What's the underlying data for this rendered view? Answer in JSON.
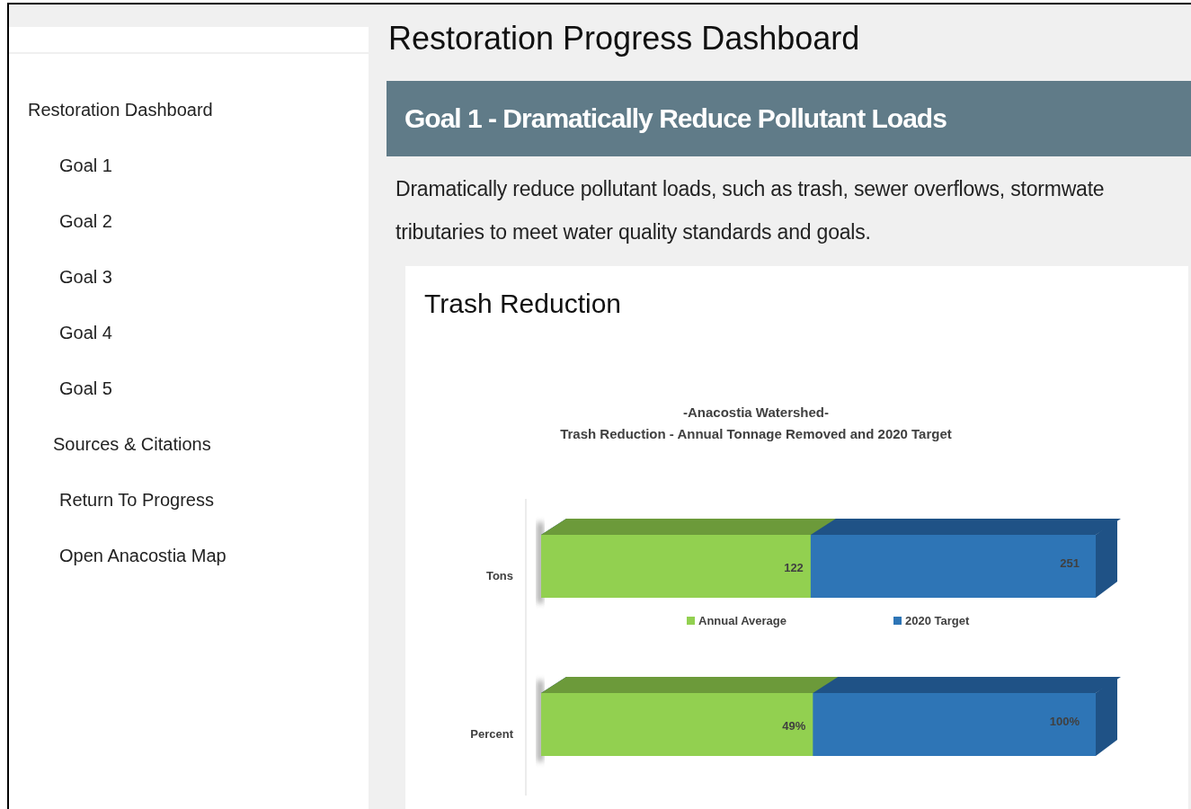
{
  "sidebar": {
    "items": [
      {
        "label": "Restoration Dashboard",
        "kind": "top"
      },
      {
        "label": "Goal 1",
        "kind": "sub"
      },
      {
        "label": "Goal 2",
        "kind": "sub"
      },
      {
        "label": "Goal 3",
        "kind": "sub"
      },
      {
        "label": "Goal 4",
        "kind": "sub"
      },
      {
        "label": "Goal 5",
        "kind": "sub"
      },
      {
        "label": "Sources & Citations",
        "kind": "mid"
      },
      {
        "label": "Return To Progress",
        "kind": "sub"
      },
      {
        "label": "Open Anacostia Map",
        "kind": "sub"
      }
    ]
  },
  "page_title": "Restoration Progress Dashboard",
  "goal": {
    "heading": "Goal 1 - Dramatically Reduce Pollutant Loads",
    "description_lines": [
      "Dramatically reduce pollutant loads, such as trash, sewer overflows, stormwate",
      "tributaries to meet water quality standards and goals."
    ]
  },
  "card": {
    "title": "Trash Reduction",
    "graphic": {
      "supertitle": "-Anacostia Watershed-",
      "title": "Trash Reduction - Annual Tonnage Removed and 2020 Target",
      "legend": [
        {
          "label": "Annual Average",
          "color": "#92d050"
        },
        {
          "label": "2020 Target",
          "color": "#2e75b6"
        }
      ],
      "rows": [
        {
          "label": "Tons",
          "level": 0.486,
          "average_label": "122",
          "target_label": "251"
        },
        {
          "label": "Percent",
          "level": 0.49,
          "average_label": "49%",
          "target_label": "100%"
        }
      ]
    }
  }
}
